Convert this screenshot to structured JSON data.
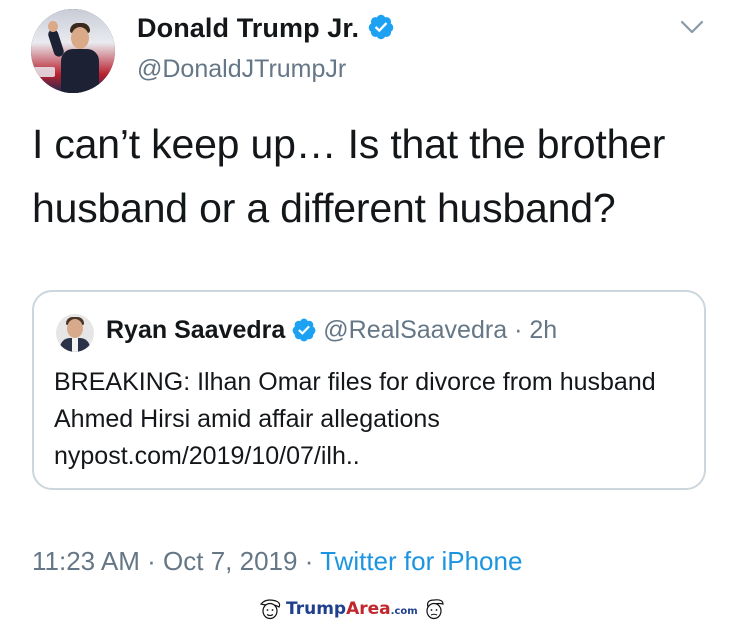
{
  "tweet": {
    "author": {
      "display_name": "Donald Trump Jr.",
      "handle": "@DonaldJTrumpJr",
      "verified": true,
      "avatar": "avatar-image"
    },
    "menu_icon": "chevron-down-icon",
    "text": "I can’t keep up… Is that the brother husband or a different husband?",
    "quoted": {
      "display_name": "Ryan Saavedra",
      "handle": "@RealSaavedra",
      "separator": "·",
      "time": "2h",
      "verified": true,
      "text": "BREAKING: Ilhan Omar files for divorce from husband Ahmed Hirsi amid affair allegations nypost.com/2019/10/07/ilh.."
    },
    "meta": {
      "time": "11:23 AM",
      "sep1": " · ",
      "date": "Oct 7, 2019",
      "sep2": " · ",
      "source": "Twitter for iPhone"
    }
  },
  "watermark": {
    "brand_part1": "Trump",
    "brand_part2": "Area",
    "domain_suffix": ".com"
  },
  "colors": {
    "verified_blue": "#1da1f2",
    "secondary_text": "#657786",
    "link_blue": "#1b95e0",
    "border": "#ccd6dd"
  }
}
